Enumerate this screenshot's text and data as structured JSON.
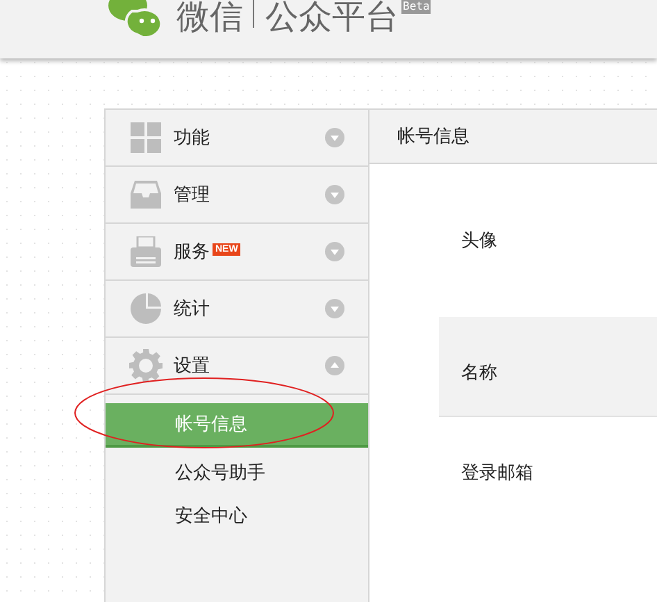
{
  "header": {
    "brand": "微信",
    "product": "公众平台",
    "badge": "Beta"
  },
  "sidebar": {
    "items": [
      {
        "kind": "grid",
        "label": "功能",
        "expanded": false
      },
      {
        "kind": "tray",
        "label": "管理",
        "expanded": false
      },
      {
        "kind": "printer",
        "label": "服务",
        "badge": "NEW",
        "expanded": false
      },
      {
        "kind": "pie",
        "label": "统计",
        "expanded": false
      },
      {
        "kind": "gear",
        "label": "设置",
        "expanded": true,
        "children": [
          {
            "label": "帐号信息",
            "selected": true
          },
          {
            "label": "公众号助手",
            "selected": false
          },
          {
            "label": "安全中心",
            "selected": false
          }
        ]
      }
    ]
  },
  "content": {
    "title": "帐号信息",
    "rows": [
      {
        "label": "头像",
        "shaded": false
      },
      {
        "label": "名称",
        "shaded": true
      },
      {
        "label": "登录邮箱",
        "shaded": false
      }
    ]
  }
}
